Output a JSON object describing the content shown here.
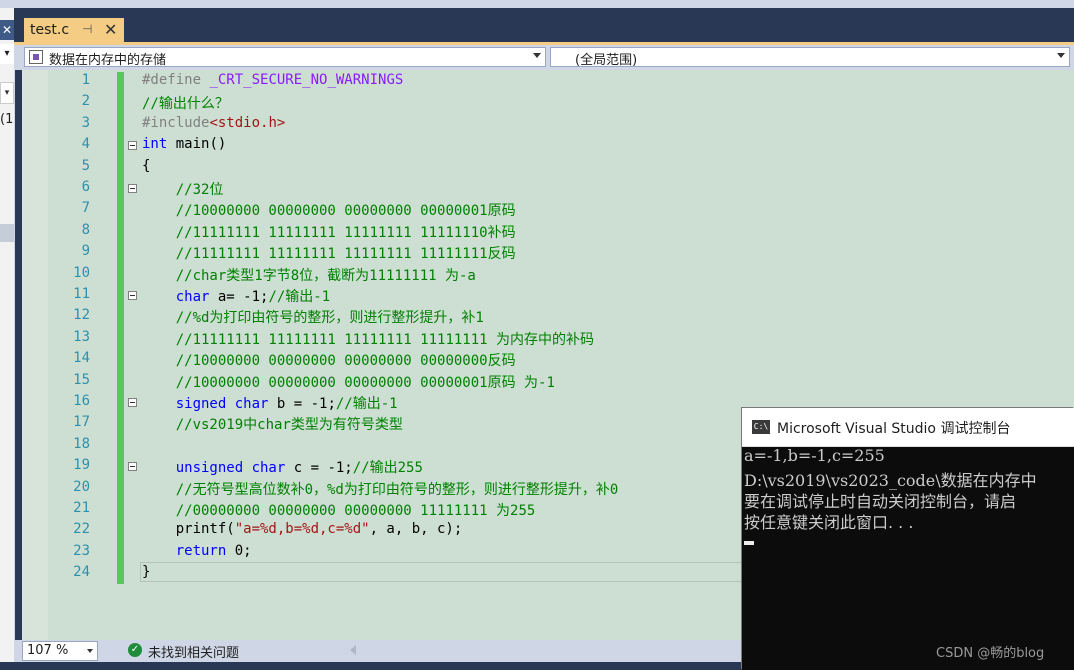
{
  "tab": {
    "title": "test.c",
    "pin": "⊣",
    "close": "✕"
  },
  "navbar": {
    "scope": "数据在内存中的存储",
    "member": "(全局范围)"
  },
  "left_panel": {
    "paren_text": "(1"
  },
  "editor": {
    "lines": [
      {
        "n": "1",
        "html": "<span class=\"c-pre\">#define </span><span class=\"c-macro\">_CRT_SECURE_NO_WARNINGS</span>"
      },
      {
        "n": "2",
        "html": "<span class=\"c-com\">//输出什么？</span>"
      },
      {
        "n": "3",
        "html": "<span class=\"c-pre\">#include</span><span class=\"c-str\">&lt;stdio.h&gt;</span>"
      },
      {
        "n": "4",
        "html": "<span class=\"c-kw\">int</span> main()"
      },
      {
        "n": "5",
        "html": "{"
      },
      {
        "n": "6",
        "html": "    <span class=\"c-com\">//32位</span>"
      },
      {
        "n": "7",
        "html": "    <span class=\"c-com\">//10000000 00000000 00000000 00000001原码</span>"
      },
      {
        "n": "8",
        "html": "    <span class=\"c-com\">//11111111 11111111 11111111 11111110补码</span>"
      },
      {
        "n": "9",
        "html": "    <span class=\"c-com\">//11111111 11111111 11111111 11111111反码</span>"
      },
      {
        "n": "10",
        "html": "    <span class=\"c-com\">//char类型1字节8位，截断为11111111 为-a</span>"
      },
      {
        "n": "11",
        "html": "    <span class=\"c-kw\">char</span> a= -1;<span class=\"c-com\">//输出-1</span>"
      },
      {
        "n": "12",
        "html": "    <span class=\"c-com\">//%d为打印由符号的整形，则进行整形提升，补1</span>"
      },
      {
        "n": "13",
        "html": "    <span class=\"c-com\">//11111111 11111111 11111111 11111111 为内存中的补码</span>"
      },
      {
        "n": "14",
        "html": "    <span class=\"c-com\">//10000000 00000000 00000000 00000000反码</span>"
      },
      {
        "n": "15",
        "html": "    <span class=\"c-com\">//10000000 00000000 00000000 00000001原码 为-1</span>"
      },
      {
        "n": "16",
        "html": "    <span class=\"c-kw\">signed char</span> b = -1;<span class=\"c-com\">//输出-1</span>"
      },
      {
        "n": "17",
        "html": "    <span class=\"c-com\">//vs2019中char类型为有符号类型</span>"
      },
      {
        "n": "18",
        "html": ""
      },
      {
        "n": "19",
        "html": "    <span class=\"c-kw\">unsigned char</span> c = -1;<span class=\"c-com\">//输出255</span>"
      },
      {
        "n": "20",
        "html": "    <span class=\"c-com\">//无符号型高位数补0，%d为打印由符号的整形，则进行整形提升，补0</span>"
      },
      {
        "n": "21",
        "html": "    <span class=\"c-com\">//00000000 00000000 00000000 11111111 为255</span>"
      },
      {
        "n": "22",
        "html": "    printf(<span class=\"c-str\">\"a=%d,b=%d,c=%d\"</span>, a, b, c);"
      },
      {
        "n": "23",
        "html": "    <span class=\"c-kw\">return</span> 0;"
      },
      {
        "n": "24",
        "html": "}"
      }
    ],
    "fold_lines": [
      4,
      6,
      11,
      16,
      19
    ]
  },
  "statusbar": {
    "zoom": "107 %",
    "issues": "未找到相关问题",
    "issues_icon": "check-circle-icon"
  },
  "console": {
    "title": "Microsoft Visual Studio 调试控制台",
    "icon_text": "C:\\",
    "lines": [
      "a=-1,b=-1,c=255",
      "D:\\vs2019\\vs2023_code\\数据在内存中",
      "要在调试停止时自动关闭控制台，请启",
      "按任意键关闭此窗口. . ."
    ],
    "watermark": "CSDN @畅的blog"
  },
  "colors": {
    "tab_active": "#f5cc84",
    "frame": "#293955",
    "editor_bg": "#cddfd3",
    "change_bar": "#57c95a"
  }
}
